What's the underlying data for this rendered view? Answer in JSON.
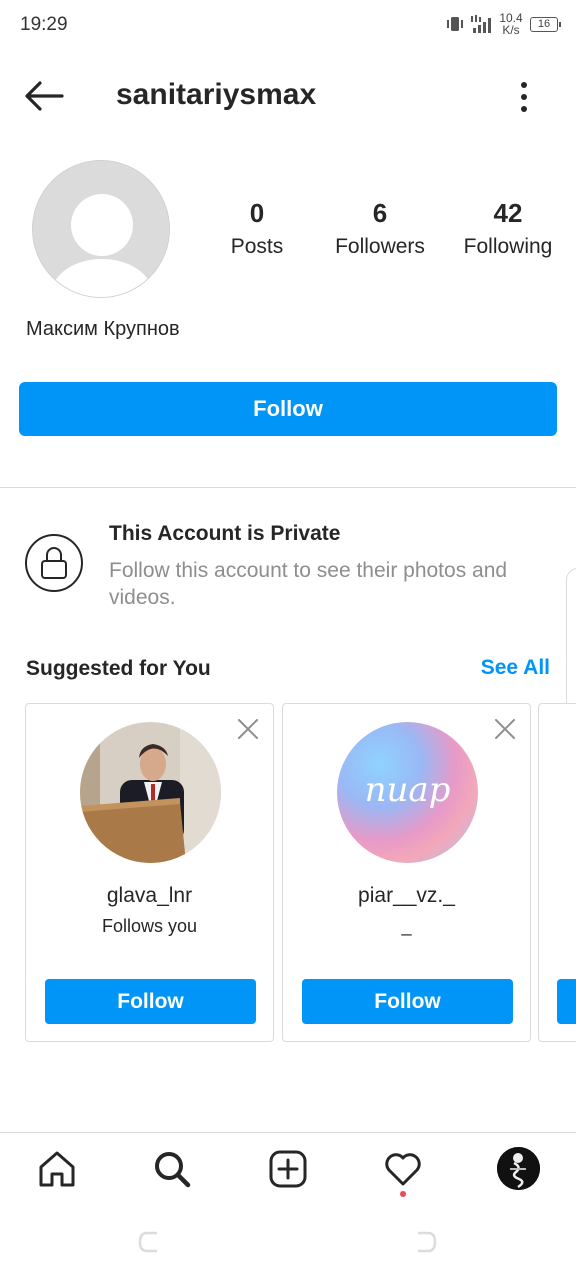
{
  "status": {
    "time": "19:29",
    "net_speed_top": "10.4",
    "net_speed_bottom": "K/s",
    "battery": "16"
  },
  "header": {
    "username": "sanitariysmax"
  },
  "profile": {
    "stats": [
      {
        "value": "0",
        "label": "Posts"
      },
      {
        "value": "6",
        "label": "Followers"
      },
      {
        "value": "42",
        "label": "Following"
      }
    ],
    "full_name": "Максим Крупнов",
    "follow_label": "Follow"
  },
  "private": {
    "title": "This Account is Private",
    "subtitle": "Follow this account to see their photos and videos."
  },
  "suggested": {
    "title": "Suggested for You",
    "see_all": "See All",
    "cards": [
      {
        "username": "glava_lnr",
        "subtitle": "Follows you",
        "button": "Follow"
      },
      {
        "username": "piar__vz._",
        "subtitle": "_",
        "avatar_text": "пиар",
        "button": "Follow"
      }
    ]
  },
  "colors": {
    "accent": "#0095f6",
    "text": "#262626",
    "secondary_text": "#8e8e8e",
    "border": "#dbdbdb",
    "notification_dot": "#ed4956"
  }
}
